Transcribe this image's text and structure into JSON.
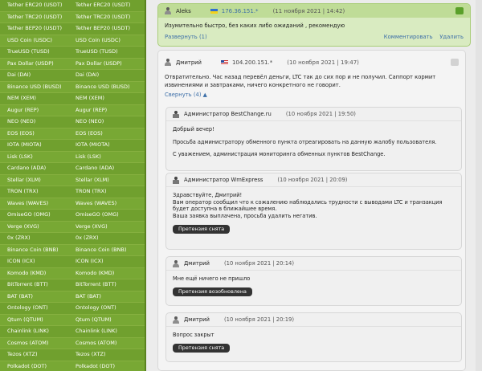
{
  "currencies": [
    [
      "Tether ERC20 (USDT)",
      "Tether ERC20 (USDT)"
    ],
    [
      "Tether TRC20 (USDT)",
      "Tether TRC20 (USDT)"
    ],
    [
      "Tether BEP20 (USDT)",
      "Tether BEP20 (USDT)"
    ],
    [
      "USD Coin (USDC)",
      "USD Coin (USDC)"
    ],
    [
      "TrueUSD (TUSD)",
      "TrueUSD (TUSD)"
    ],
    [
      "Pax Dollar (USDP)",
      "Pax Dollar (USDP)"
    ],
    [
      "Dai (DAI)",
      "Dai (DAI)"
    ],
    [
      "Binance USD (BUSD)",
      "Binance USD (BUSD)"
    ],
    [
      "NEM (XEM)",
      "NEM (XEM)"
    ],
    [
      "Augur (REP)",
      "Augur (REP)"
    ],
    [
      "NEO (NEO)",
      "NEO (NEO)"
    ],
    [
      "EOS (EOS)",
      "EOS (EOS)"
    ],
    [
      "IOTA (MIOTA)",
      "IOTA (MIOTA)"
    ],
    [
      "Lisk (LSK)",
      "Lisk (LSK)"
    ],
    [
      "Cardano (ADA)",
      "Cardano (ADA)"
    ],
    [
      "Stellar (XLM)",
      "Stellar (XLM)"
    ],
    [
      "TRON (TRX)",
      "TRON (TRX)"
    ],
    [
      "Waves (WAVES)",
      "Waves (WAVES)"
    ],
    [
      "OmiseGO (OMG)",
      "OmiseGO (OMG)"
    ],
    [
      "Verge (XVG)",
      "Verge (XVG)"
    ],
    [
      "0x (ZRX)",
      "0x (ZRX)"
    ],
    [
      "Binance Coin (BNB)",
      "Binance Coin (BNB)"
    ],
    [
      "ICON (ICX)",
      "ICON (ICX)"
    ],
    [
      "Komodo (KMD)",
      "Komodo (KMD)"
    ],
    [
      "BitTorrent (BTT)",
      "BitTorrent (BTT)"
    ],
    [
      "BAT (BAT)",
      "BAT (BAT)"
    ],
    [
      "Ontology (ONT)",
      "Ontology (ONT)"
    ],
    [
      "Qtum (QTUM)",
      "Qtum (QTUM)"
    ],
    [
      "Chainlink (LINK)",
      "Chainlink (LINK)"
    ],
    [
      "Cosmos (ATOM)",
      "Cosmos (ATOM)"
    ],
    [
      "Tezos (XTZ)",
      "Tezos (XTZ)"
    ],
    [
      "Polkadot (DOT)",
      "Polkadot (DOT)"
    ]
  ],
  "top_comment": {
    "author": "Aleks",
    "ip": "176.36.151.*",
    "date": "(11 ноября 2021 | 14:42)",
    "text": "Изумительно быстро, без каких либо ожиданий , рекомендую",
    "expand": "Развернуть (1)",
    "comment_link": "Комментировать",
    "delete_link": "Удалить"
  },
  "main_comment": {
    "author": "Дмитрий",
    "ip": "104.200.151.*",
    "date": "(10 ноября 2021 | 19:47)",
    "text": "Отвратительно. Час назад перевёл деньги, LTC так до сих пор и не получил. Саппорт кормит извинениями и завтраками, ничего конкретного не говорит.",
    "collapse": "Свернуть (4)"
  },
  "replies": [
    {
      "author": "Администратор BestChange.ru",
      "date": "(10 ноября 2021 | 19:50)",
      "lines": [
        "Добрый вечер!",
        "Просьба администратору обменного пункта отреагировать на данную жалобу пользователя.",
        "С уважением, администрация мониторинга обменных пунктов BestChange."
      ],
      "badge": ""
    },
    {
      "author": "Администратор WmExpress",
      "date": "(10 ноября 2021 | 20:09)",
      "lines": [
        "Здравствуйте, Дмитрий!\nВам оператор сообщил что к сожалению наблюдались трудности с выводами LTC и транзакция будет доступна в ближайшее время.\nВаша заявка выплачена, просьба удалить негатив."
      ],
      "badge": "Претензия снята"
    },
    {
      "author": "Дмитрий",
      "date": "(10 ноября 2021 | 20:14)",
      "lines": [
        "Мне ещё ничего не пришло"
      ],
      "badge": "Претензия возобновлена"
    },
    {
      "author": "Дмитрий",
      "date": "(10 ноября 2021 | 20:19)",
      "lines": [
        "Вопрос закрыт"
      ],
      "badge": "Претензия снята"
    }
  ]
}
